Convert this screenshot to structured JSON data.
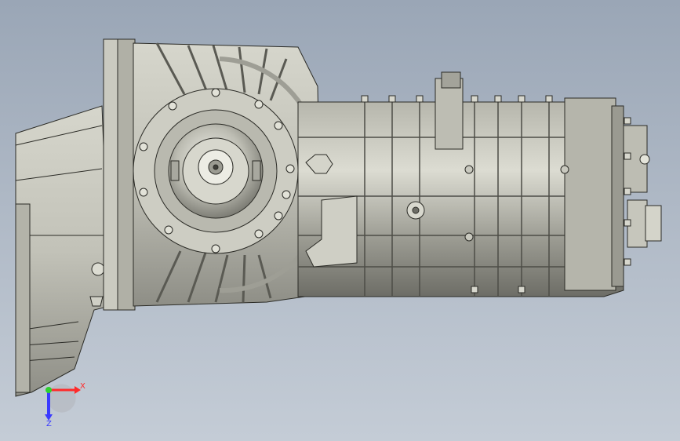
{
  "viewport": {
    "background_top": "#9aa6b6",
    "background_bottom": "#c4ccd6",
    "model_fill": "#c9c9bf",
    "model_shadow": "#8f8f86",
    "model_edge": "#2b2b26"
  },
  "triad": {
    "x_label": "X",
    "z_label": "Z",
    "x_color": "#ff2a2a",
    "y_color": "#2fd12f",
    "z_color": "#3a3aff"
  }
}
